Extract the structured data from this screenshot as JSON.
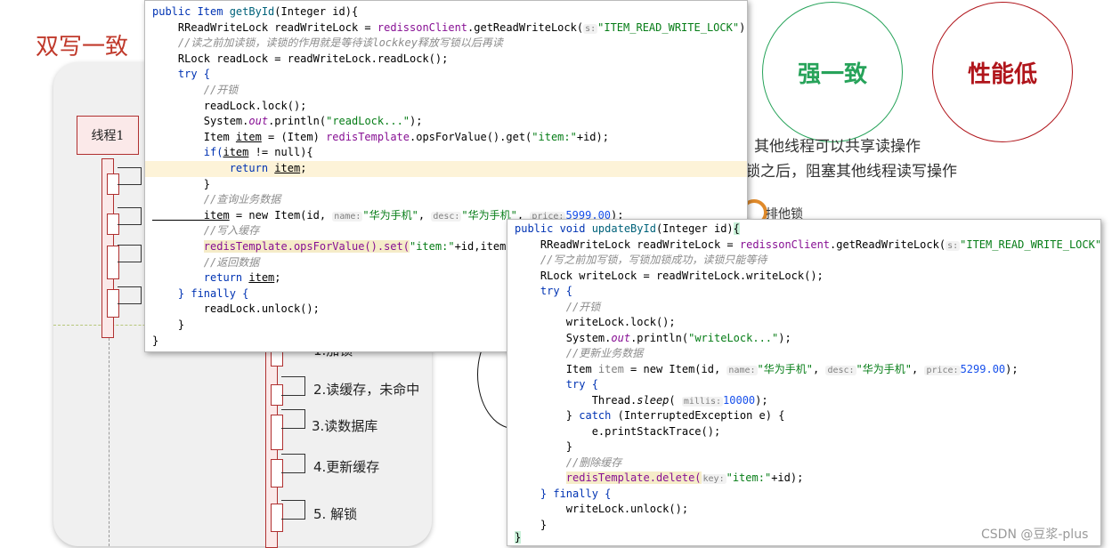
{
  "slide": {
    "title": "双写一致",
    "thread_label": "线程1",
    "steps": [
      "1.加锁",
      "2.读缓存，未命中",
      "3.读数据库",
      "4.更新缓存",
      "5.  解锁"
    ],
    "circle_strong": "强一致",
    "circle_low": "性能低",
    "text_line1": "其他线程可以共享读操作",
    "text_line2": "锁之后，阻塞其他线程读写操作",
    "exclusive_lock": "排他锁",
    "watermark": "CSDN @豆浆-plus",
    "colors": {
      "green": "#27a35a",
      "red": "#b0151b",
      "title": "#c0392b"
    }
  },
  "read_code": {
    "l1a": "public Item ",
    "l1b": "getById",
    "l1c": "(Integer id){",
    "l2a": "    RReadWriteLock readWriteLock = ",
    "l2b": "redissonClient",
    "l2c": ".getReadWriteLock(",
    "l2hint": "s:",
    "l2d": "\"ITEM_READ_WRITE_LOCK\"",
    "l2e": ");",
    "l3": "    //读之前加读锁，读锁的作用就是等待该lockkey释放写锁以后再读",
    "l4": "    RLock readLock = readWriteLock.readLock();",
    "l5": "    try {",
    "l6": "        //开锁",
    "l7": "        readLock.lock();",
    "l8a": "        System.",
    "l8b": "out",
    "l8c": ".println(",
    "l8d": "\"readLock...\"",
    "l8e": ");",
    "l9a": "        Item ",
    "l9b": "item",
    "l9c": " = (Item) ",
    "l9d": "redisTemplate",
    "l9e": ".opsForValue().get(",
    "l9f": "\"item:\"",
    "l9g": "+id);",
    "l10a": "        if(",
    "l10b": "item",
    "l10c": " != null){",
    "l11a": "            return ",
    "l11b": "item",
    "l11c": ";",
    "l12": "        }",
    "l13": "        //查询业务数据",
    "l14a": "        item",
    "l14b": " = new Item(id, ",
    "l14hint1": "name:",
    "l14c": "\"华为手机\"",
    "l14d": ", ",
    "l14hint2": "desc:",
    "l14e": "\"华为手机\"",
    "l14f": ", ",
    "l14hint3": "price:",
    "l14g": "5999.00",
    "l14h": ");",
    "l15": "        //写入缓存",
    "l16a": "        ",
    "l16b": "redisTemplate.opsForValue().set(",
    "l16c": "\"item:\"",
    "l16d": "+id,item)",
    "l17": "        //返回数据",
    "l18a": "        return ",
    "l18b": "item",
    "l18c": ";",
    "l19": "    } finally {",
    "l20": "        readLock.unlock();",
    "l21": "    }",
    "l22": "}"
  },
  "write_code": {
    "l1a": "public void ",
    "l1b": "updateById",
    "l1c": "(Integer id)",
    "l1d": "{",
    "l2a": "    RReadWriteLock readWriteLock = ",
    "l2b": "redissonClient",
    "l2c": ".getReadWriteLock(",
    "l2hint": "s:",
    "l2d": "\"ITEM_READ_WRITE_LOCK\"",
    "l2e": ");",
    "l3": "    //写之前加写锁，写锁加锁成功，读锁只能等待",
    "l4": "    RLock writeLock = readWriteLock.writeLock();",
    "l5": "    try {",
    "l6": "        //开锁",
    "l7": "        writeLock.lock();",
    "l8a": "        System.",
    "l8b": "out",
    "l8c": ".println(",
    "l8d": "\"writeLock...\"",
    "l8e": ");",
    "l9": "        //更新业务数据",
    "l10a": "        Item ",
    "l10b": "item",
    "l10c": " = new Item(id, ",
    "l10hint1": "name:",
    "l10d": "\"华为手机\"",
    "l10e": ", ",
    "l10hint2": "desc:",
    "l10f": "\"华为手机\"",
    "l10g": ", ",
    "l10hint3": "price:",
    "l10h": "5299.00",
    "l10i": ");",
    "l11": "        try {",
    "l12a": "            Thread.",
    "l12b": "sleep",
    "l12c": "( ",
    "l12hint": "millis:",
    "l12d": "10000",
    "l12e": ");",
    "l13a": "        } ",
    "l13b": "catch",
    "l13c": " (InterruptedException e) {",
    "l14": "            e.printStackTrace();",
    "l15": "        }",
    "l16": "        //删除缓存",
    "l17a": "        ",
    "l17b": "redisTemplate.delete(",
    "l17hint": "key:",
    "l17c": "\"item:\"",
    "l17d": "+id);",
    "l18": "    } finally {",
    "l19": "        writeLock.unlock();",
    "l20": "    }",
    "l21": "}"
  }
}
